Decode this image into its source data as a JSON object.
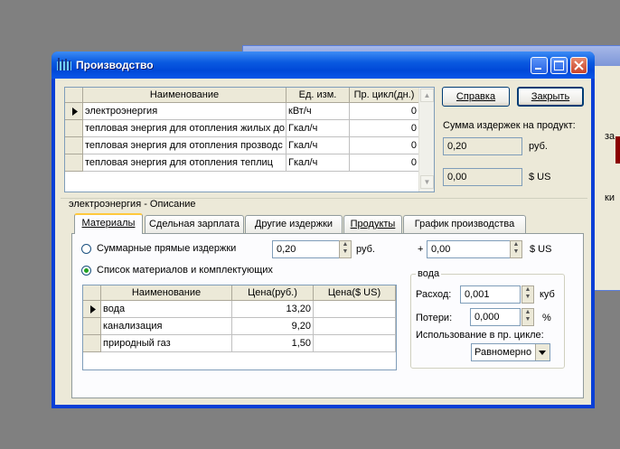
{
  "background_window": {
    "text_1": "за",
    "text_2": "ки"
  },
  "window": {
    "title": "Производство"
  },
  "main_grid": {
    "columns": [
      "Наименование",
      "Ед. изм.",
      "Пр. цикл(дн.)"
    ],
    "rows": [
      {
        "name": "электроэнергия",
        "unit": "кВт/ч",
        "cycle": "0"
      },
      {
        "name": "тепловая энергия для отопления жилых до",
        "unit": "Гкал/ч",
        "cycle": "0"
      },
      {
        "name": "тепловая энергия для отопления прозводс",
        "unit": "Гкал/ч",
        "cycle": "0"
      },
      {
        "name": "тепловая энергия для отопления теплиц",
        "unit": "Гкал/ч",
        "cycle": "0"
      }
    ]
  },
  "buttons": {
    "help": "Справка",
    "close": "Закрыть"
  },
  "summary": {
    "label": "Сумма издержек на продукт:",
    "rub_value": "0,20",
    "rub_unit": "руб.",
    "usd_value": "0,00",
    "usd_unit": "$ US"
  },
  "description": {
    "label": "электроэнергия - Описание"
  },
  "tabs": [
    {
      "label": "Материалы"
    },
    {
      "label": "Сдельная зарплата"
    },
    {
      "label": "Другие издержки"
    },
    {
      "label": "Продукты"
    },
    {
      "label": "График производства"
    }
  ],
  "materials": {
    "radio_total_label": "Суммарные прямые издержки",
    "total_rub_value": "0,20",
    "total_rub_unit": "руб.",
    "plus_sign": "+",
    "total_usd_value": "0,00",
    "total_usd_unit": "$ US",
    "radio_list_label": "Список материалов и комплектующих",
    "grid_columns": [
      "Наименование",
      "Цена(руб.)",
      "Цена($ US)"
    ],
    "grid_rows": [
      {
        "name": "вода",
        "price_rub": "13,20",
        "price_usd": ""
      },
      {
        "name": "канализация",
        "price_rub": "9,20",
        "price_usd": ""
      },
      {
        "name": "природный газ",
        "price_rub": "1,50",
        "price_usd": ""
      }
    ]
  },
  "water_group": {
    "title": "вода",
    "consumption_label": "Расход:",
    "consumption_value": "0,001",
    "consumption_unit": "куб",
    "loss_label": "Потери:",
    "loss_value": "0,000",
    "loss_unit": "%",
    "usage_label": "Использование в пр. цикле:",
    "usage_value": "Равномерно"
  },
  "colors": {
    "titlebar": "#0a56e8",
    "face": "#ece9d8",
    "close_button": "#c8432a"
  }
}
